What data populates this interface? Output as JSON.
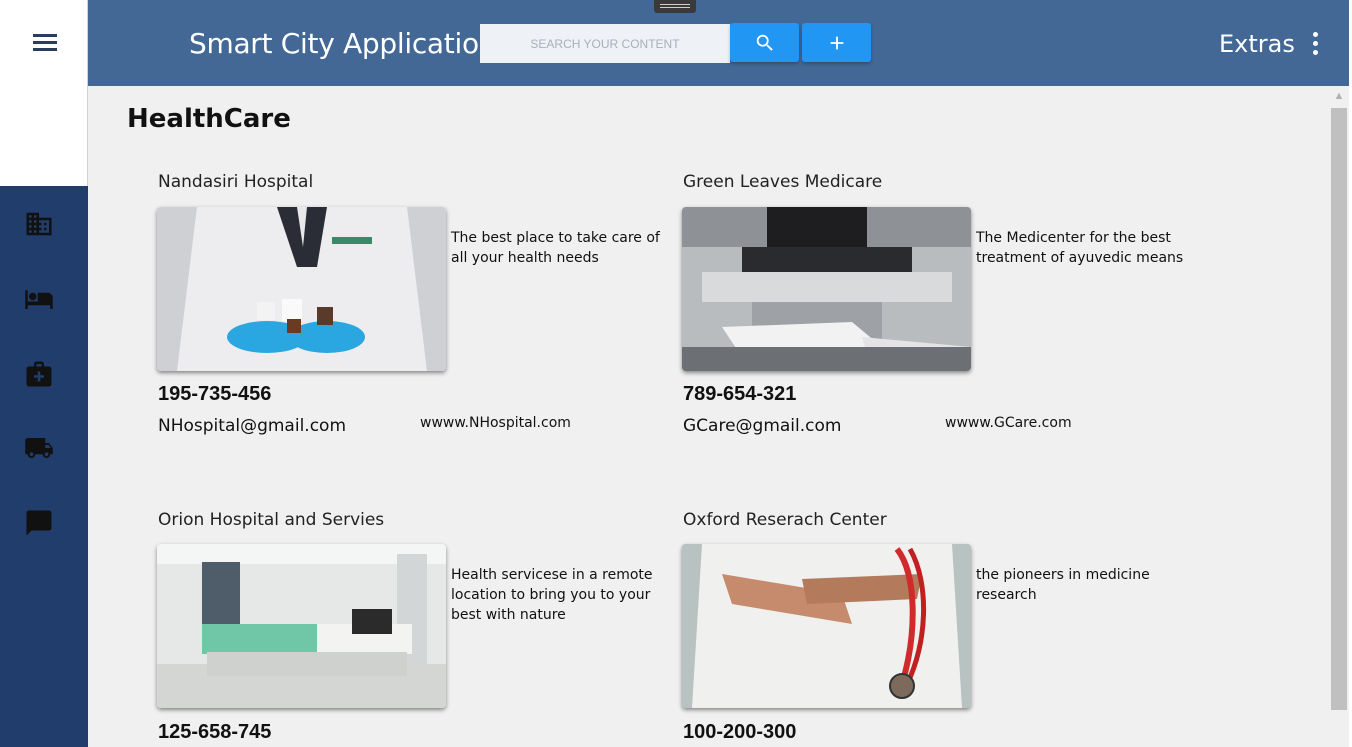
{
  "header": {
    "title": "Smart City Application",
    "search_placeholder": "SEARCH YOUR CONTENT",
    "extras_label": "Extras",
    "search_button_icon": "search-icon",
    "add_button_icon": "plus-icon",
    "accent_color": "#2196f3",
    "header_color": "#436896"
  },
  "nav": {
    "menu_icon": "hamburger-menu-icon",
    "items": [
      {
        "icon": "building-icon"
      },
      {
        "icon": "bed-icon"
      },
      {
        "icon": "medical-bag-icon"
      },
      {
        "icon": "truck-icon"
      },
      {
        "icon": "chat-icon"
      }
    ],
    "rail_color": "#203d6b"
  },
  "main": {
    "section_title": "HealthCare",
    "cards": [
      {
        "name": "Nandasiri Hospital",
        "description": "The best place to take care of all your health needs",
        "phone": "195-735-456",
        "email": "NHospital@gmail.com",
        "website": "wwww.NHospital.com"
      },
      {
        "name": "Green Leaves Medicare",
        "description": "The Medicenter for the best treatment of ayuvedic means",
        "phone": "789-654-321",
        "email": "GCare@gmail.com",
        "website": "wwww.GCare.com"
      },
      {
        "name": "Orion Hospital and Servies",
        "description": "Health servicese in a remote location to bring you to your best with nature",
        "phone": "125-658-745"
      },
      {
        "name": "Oxford Reserach Center",
        "description": "the pioneers in medicine research",
        "phone": "100-200-300"
      }
    ]
  }
}
